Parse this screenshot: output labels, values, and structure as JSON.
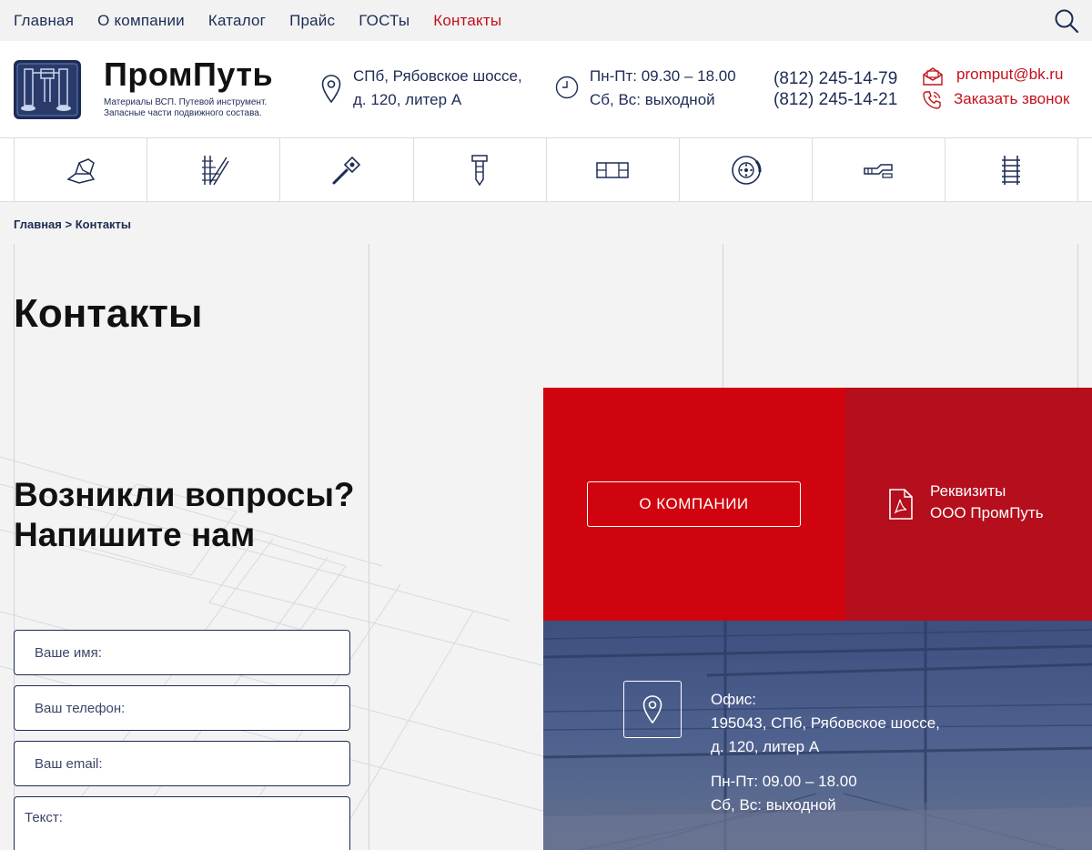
{
  "nav": {
    "items": [
      {
        "label": "Главная",
        "active": false
      },
      {
        "label": "О компании",
        "active": false
      },
      {
        "label": "Каталог",
        "active": false
      },
      {
        "label": "Прайс",
        "active": false
      },
      {
        "label": "ГОСТы",
        "active": false
      },
      {
        "label": "Контакты",
        "active": true
      }
    ],
    "search_icon": "search-icon"
  },
  "header": {
    "brand_name": "ПромПуть",
    "brand_sub_line1": "Материалы ВСП. Путевой инструмент.",
    "brand_sub_line2": "Запасные части подвижного состава.",
    "address_line1": "СПб, Рябовское шоссе,",
    "address_line2": "д. 120, литер А",
    "hours_line1": "Пн-Пт: 09.30 – 18.00",
    "hours_line2": "Сб, Вс: выходной",
    "phone1": "(812) 245-14-79",
    "phone2": "(812) 245-14-21",
    "email": "promput@bk.ru",
    "callback": "Заказать звонок"
  },
  "categories": [
    {
      "icon": "rail-profile-icon"
    },
    {
      "icon": "rail-switch-icon"
    },
    {
      "icon": "hammer-icon"
    },
    {
      "icon": "spike-icon"
    },
    {
      "icon": "sleeper-plate-icon"
    },
    {
      "icon": "brake-disc-icon"
    },
    {
      "icon": "coupler-icon"
    },
    {
      "icon": "track-ladder-icon"
    }
  ],
  "breadcrumb": {
    "home": "Главная",
    "separator": ">",
    "current": "Контакты"
  },
  "page_title": "Контакты",
  "form": {
    "heading_line1": "Возникли вопросы?",
    "heading_line2": "Напишите нам",
    "name_placeholder": "Ваше имя:",
    "phone_placeholder": "Ваш телефон:",
    "email_placeholder": "Ваш email:",
    "text_placeholder": "Текст:"
  },
  "panels": {
    "about_button": "О КОМПАНИИ",
    "requisites_line1": "Реквизиты",
    "requisites_line2": "ООО ПромПуть"
  },
  "office": {
    "label": "Офис:",
    "address_line1": "195043, СПб, Рябовское шоссе,",
    "address_line2": "д. 120, литер А",
    "hours_line1": "Пн-Пт: 09.00 – 18.00",
    "hours_line2": "Сб, Вс: выходной"
  },
  "colors": {
    "brand_blue": "#1d2c55",
    "accent_red": "#c4101b",
    "panel_red": "#d0040f",
    "panel_dark_red": "#b50e1c"
  }
}
